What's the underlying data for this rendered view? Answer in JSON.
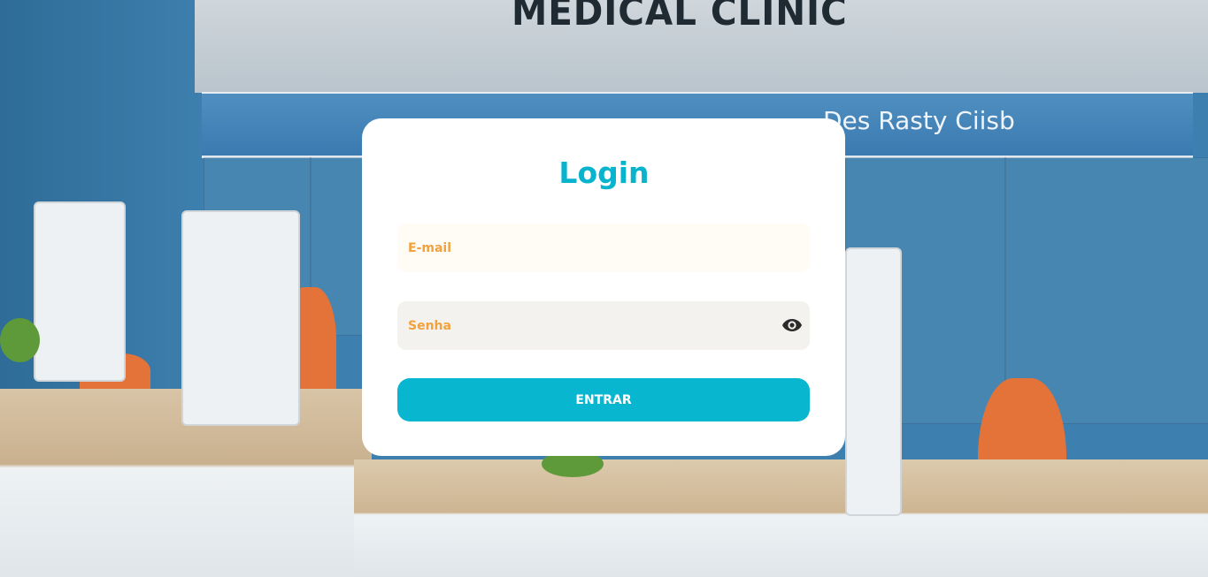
{
  "background": {
    "clinic_sign": "MEDICAL CLINIC",
    "sign_bar_text": "Des Rasty Ciisb"
  },
  "login": {
    "title": "Login",
    "email_placeholder": "E-mail",
    "password_placeholder": "Senha",
    "toggle_icon": "eye-icon",
    "submit_label": "ENTRAR"
  },
  "colors": {
    "accent": "#08b7cf",
    "placeholder": "#f1a13d",
    "card": "#ffffff"
  }
}
